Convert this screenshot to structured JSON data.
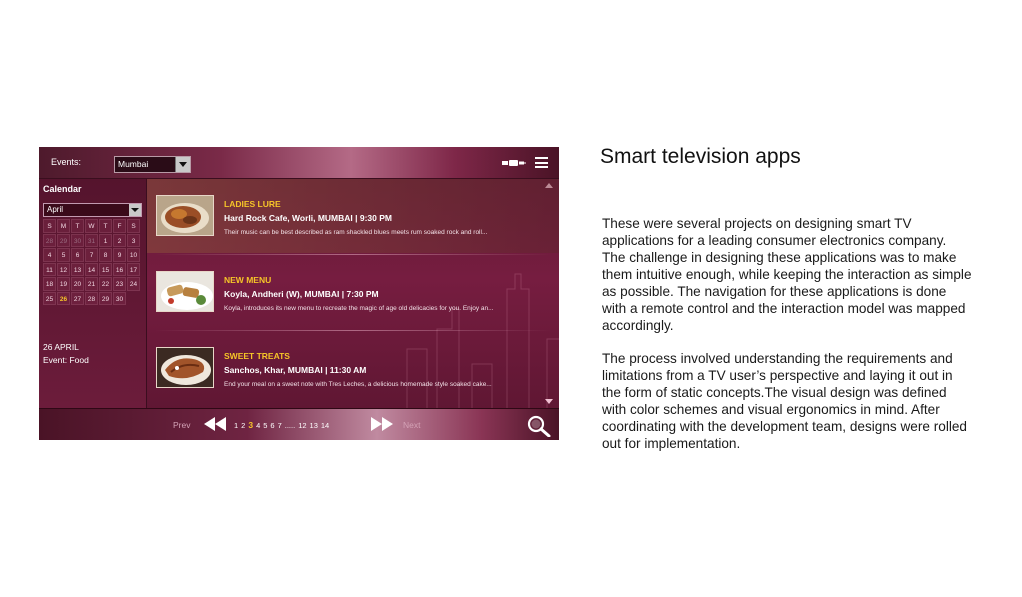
{
  "tv_app": {
    "header": {
      "events_label": "Events:",
      "city_value": "Mumbai"
    },
    "calendar": {
      "title": "Calendar",
      "month_value": "April",
      "weekday_headers": [
        "S",
        "M",
        "T",
        "W",
        "T",
        "F",
        "S"
      ],
      "days": [
        {
          "d": "28",
          "dim": true
        },
        {
          "d": "29",
          "dim": true
        },
        {
          "d": "30",
          "dim": true
        },
        {
          "d": "31",
          "dim": true
        },
        {
          "d": "1",
          "dim": false
        },
        {
          "d": "2",
          "dim": false
        },
        {
          "d": "3",
          "dim": false
        },
        {
          "d": "4",
          "dim": false
        },
        {
          "d": "5",
          "dim": false
        },
        {
          "d": "6",
          "dim": false
        },
        {
          "d": "7",
          "dim": false
        },
        {
          "d": "8",
          "dim": false
        },
        {
          "d": "9",
          "dim": false
        },
        {
          "d": "10",
          "dim": false
        },
        {
          "d": "11",
          "dim": false
        },
        {
          "d": "12",
          "dim": false
        },
        {
          "d": "13",
          "dim": false
        },
        {
          "d": "14",
          "dim": false
        },
        {
          "d": "15",
          "dim": false
        },
        {
          "d": "16",
          "dim": false
        },
        {
          "d": "17",
          "dim": false
        },
        {
          "d": "18",
          "dim": false
        },
        {
          "d": "19",
          "dim": false
        },
        {
          "d": "20",
          "dim": false
        },
        {
          "d": "21",
          "dim": false
        },
        {
          "d": "22",
          "dim": false
        },
        {
          "d": "23",
          "dim": false
        },
        {
          "d": "24",
          "dim": false
        },
        {
          "d": "25",
          "dim": false
        },
        {
          "d": "26",
          "dim": false,
          "selected": true
        },
        {
          "d": "27",
          "dim": false
        },
        {
          "d": "28",
          "dim": false
        },
        {
          "d": "29",
          "dim": false
        },
        {
          "d": "30",
          "dim": false
        }
      ],
      "selected_date": "26 APRIL",
      "selected_event": "Event:  Food"
    },
    "events": [
      {
        "title": "LADIES LURE",
        "venue": "Hard Rock Cafe, Worli, MUMBAI  |  9:30 PM",
        "desc": "Their music can be best described as ram shackled blues meets rum soaked rock and roll...",
        "highlighted": true
      },
      {
        "title": "NEW MENU",
        "venue": "Koyla, Andheri (W), MUMBAI  |  7:30 PM",
        "desc": "Koyla, introduces its new menu to recreate the magic of age old delicacies for you. Enjoy an...",
        "highlighted": false
      },
      {
        "title": "SWEET TREATS",
        "venue": "Sanchos, Khar, MUMBAI  |  11:30 AM",
        "desc": "End your meal on a sweet note with Tres Leches, a delicious homemade style soaked cake...",
        "highlighted": false
      }
    ],
    "pager": {
      "prev": "Prev",
      "next": "Next",
      "pages": [
        {
          "label": "1",
          "current": false
        },
        {
          "label": "2",
          "current": false
        },
        {
          "label": "3",
          "current": true
        },
        {
          "label": "4",
          "current": false
        },
        {
          "label": "5",
          "current": false
        },
        {
          "label": "6",
          "current": false
        },
        {
          "label": "7",
          "current": false
        },
        {
          "label": ".....",
          "current": false
        },
        {
          "label": "12",
          "current": false
        },
        {
          "label": "13",
          "current": false
        },
        {
          "label": "14",
          "current": false
        }
      ]
    },
    "colors": {
      "accent_yellow": "#f6c528",
      "maroon": "#761d40"
    }
  },
  "article": {
    "heading": "Smart television apps",
    "paragraph1": "These were several projects on designing smart TV applications for a leading consumer electronics company. The challenge in designing these applications was to make them intuitive enough, while keeping the interaction as simple as possible. The navigation for these applications is done with a remote control and the interaction model was mapped accordingly.",
    "paragraph2": "The process involved understanding the requirements and limitations from a TV user’s perspective and laying it out in the form of static concepts.The visual design was defined with color schemes and visual ergonomics in mind. After coordinating with the development team, designs were rolled out for implementation."
  }
}
